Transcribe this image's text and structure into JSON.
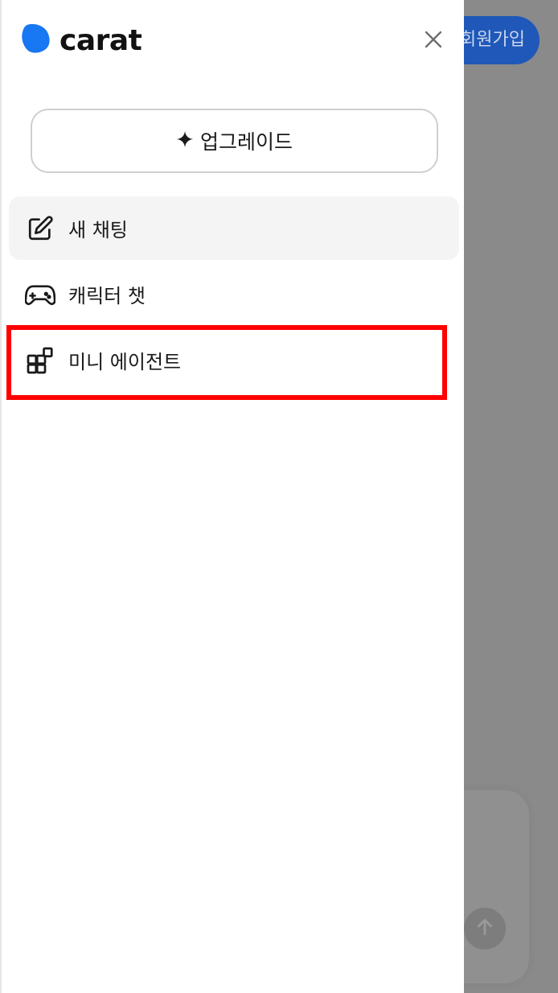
{
  "app": {
    "logo_text": "carat",
    "brand_color": "#1877f2"
  },
  "background": {
    "signup_label": "회원가입",
    "send_icon": "arrow-up-icon"
  },
  "drawer": {
    "close_icon": "close-icon",
    "upgrade_button": {
      "icon": "sparkle-icon",
      "label": "업그레이드"
    },
    "nav_items": [
      {
        "icon": "edit-icon",
        "label": "새 채팅",
        "active": true
      },
      {
        "icon": "gamepad-icon",
        "label": "캐릭터 챗",
        "active": false
      },
      {
        "icon": "grid-icon",
        "label": "미니 에이전트",
        "active": false,
        "highlighted": true
      }
    ]
  },
  "annotation": {
    "highlight_color": "#ff0000"
  }
}
